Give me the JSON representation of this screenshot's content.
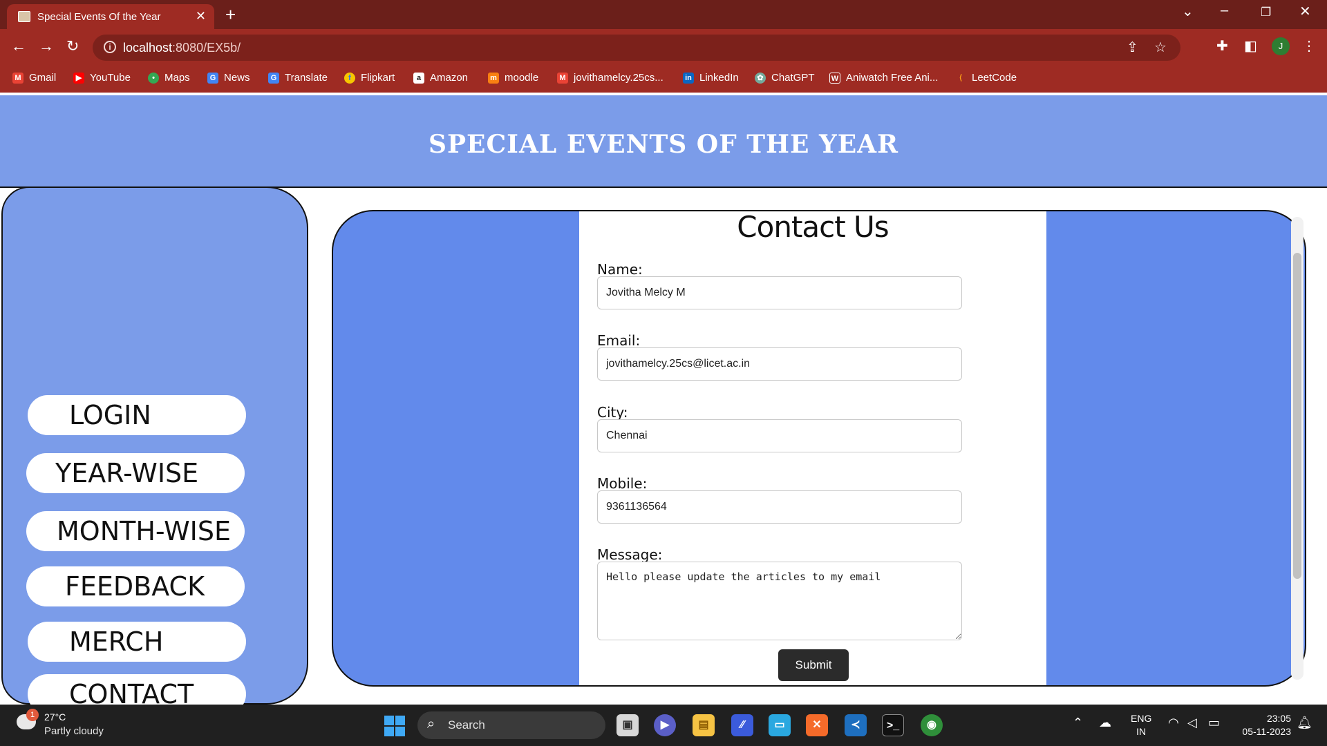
{
  "browser": {
    "tab_title": "Special Events Of the Year",
    "new_tab": "+",
    "url_host": "localhost",
    "url_path": ":8080/EX5b/",
    "bookmarks": [
      {
        "label": "Gmail",
        "icon": "gmail-icon",
        "color": "#ea4335"
      },
      {
        "label": "YouTube",
        "icon": "youtube-icon",
        "color": "#ff0000"
      },
      {
        "label": "Maps",
        "icon": "maps-icon",
        "color": "#34a853"
      },
      {
        "label": "News",
        "icon": "news-icon",
        "color": "#4285f4"
      },
      {
        "label": "Translate",
        "icon": "translate-icon",
        "color": "#4285f4"
      },
      {
        "label": "Flipkart",
        "icon": "flipkart-icon",
        "color": "#f7c600"
      },
      {
        "label": "Amazon",
        "icon": "amazon-icon",
        "color": "#222222"
      },
      {
        "label": "moodle",
        "icon": "moodle-icon",
        "color": "#f98012"
      },
      {
        "label": "jovithamelcy.25cs...",
        "icon": "gmail-icon",
        "color": "#ea4335"
      },
      {
        "label": "LinkedIn",
        "icon": "linkedin-icon",
        "color": "#0a66c2"
      },
      {
        "label": "ChatGPT",
        "icon": "chatgpt-icon",
        "color": "#74aa9c"
      },
      {
        "label": "Aniwatch Free Ani...",
        "icon": "aniwatch-icon",
        "color": "#9e2b23"
      },
      {
        "label": "LeetCode",
        "icon": "leetcode-icon",
        "color": "#ffa116"
      }
    ],
    "profile_initial": "J"
  },
  "page": {
    "header_title": "SPECIAL EVENTS OF THE YEAR",
    "nav": [
      "LOGIN",
      "YEAR-WISE",
      "MONTH-WISE",
      "FEEDBACK",
      "MERCH",
      "CONTACT"
    ],
    "form": {
      "title": "Contact Us",
      "name_label": "Name:",
      "name_value": "Jovitha Melcy M",
      "email_label": "Email:",
      "email_value": "jovithamelcy.25cs@licet.ac.in",
      "city_label": "City:",
      "city_value": "Chennai",
      "mobile_label": "Mobile:",
      "mobile_value": "9361136564",
      "message_label": "Message:",
      "message_value": "Hello please update the articles to my email",
      "submit_label": "Submit"
    }
  },
  "taskbar": {
    "temperature": "27°C",
    "weather": "Partly cloudy",
    "weather_badge": "1",
    "search": "Search",
    "lang_top": "ENG",
    "lang_bottom": "IN",
    "time": "23:05",
    "date": "05-11-2023"
  },
  "colors": {
    "chrome_dark": "#6b1f1a",
    "chrome": "#9e2b23",
    "header_blue": "#7b9ce9",
    "content_blue": "#628aeb"
  }
}
